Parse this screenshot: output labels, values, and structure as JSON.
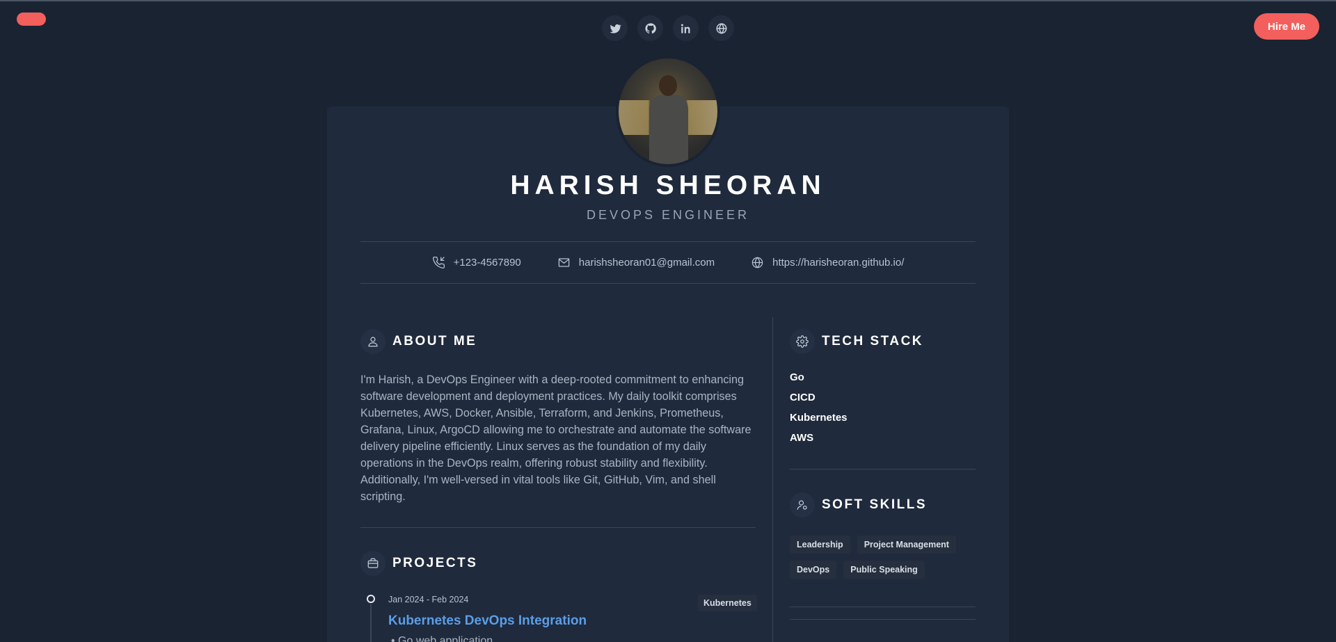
{
  "header": {
    "social_links": [
      {
        "icon": "twitter-icon"
      },
      {
        "icon": "github-icon"
      },
      {
        "icon": "linkedin-icon"
      },
      {
        "icon": "globe-icon"
      }
    ],
    "hire_label": "Hire Me"
  },
  "profile": {
    "name": "HARISH SHEORAN",
    "role": "DEVOPS ENGINEER"
  },
  "contact": {
    "phone": "+123-4567890",
    "email": "harishsheoran01@gmail.com",
    "website": "https://harisheoran.github.io/"
  },
  "about": {
    "title": "ABOUT ME",
    "text": "I'm Harish, a DevOps Engineer with a deep-rooted commitment to enhancing software development and deployment practices. My daily toolkit comprises Kubernetes, AWS, Docker, Ansible, Terraform, and Jenkins, Prometheus, Grafana, Linux, ArgoCD allowing me to orchestrate and automate the software delivery pipeline efficiently. Linux serves as the foundation of my daily operations in the DevOps realm, offering robust stability and flexibility. Additionally, I'm well-versed in vital tools like Git, GitHub, Vim, and shell scripting."
  },
  "tech_stack": {
    "title": "TECH STACK",
    "items": [
      "Go",
      "CICD",
      "Kubernetes",
      "AWS"
    ]
  },
  "soft_skills": {
    "title": "SOFT SKILLS",
    "items": [
      "Leadership",
      "Project Management",
      "DevOps",
      "Public Speaking"
    ]
  },
  "projects": {
    "title": "PROJECTS",
    "items": [
      {
        "date": "Jan 2024 - Feb 2024",
        "tag": "Kubernetes",
        "title": "Kubernetes DevOps Integration",
        "bullet": "• Go web application"
      }
    ]
  },
  "colors": {
    "background": "#1a2332",
    "card": "#1f2a3c",
    "accent": "#f25f5c",
    "link": "#5b9ee8"
  }
}
